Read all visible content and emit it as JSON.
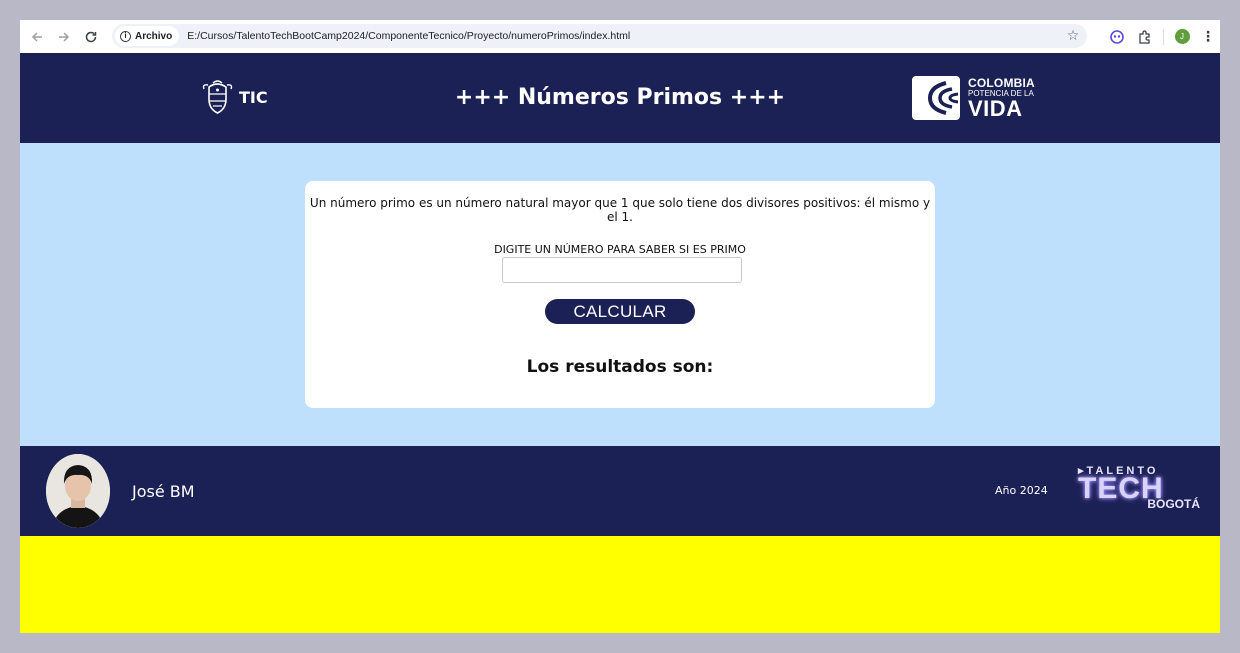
{
  "browser": {
    "chip_label": "Archivo",
    "url": "E:/Cursos/TalentoTechBootCamp2024/ComponenteTecnico/Proyecto/numeroPrimos/index.html",
    "profile_initial": "J"
  },
  "header": {
    "left_logo_text": "TIC",
    "title": "+++ Números Primos +++",
    "right_logo": {
      "line1": "COLOMBIA",
      "line2": "POTENCIA DE LA",
      "line3": "VIDA"
    }
  },
  "card": {
    "description": "Un número primo es un número natural mayor que 1 que solo tiene dos divisores positivos: él mismo y el 1.",
    "input_label": "DIGITE UN NÚMERO PARA SABER SI ES PRIMO",
    "input_value": "",
    "button_label": "CALCULAR",
    "results_heading": "Los resultados son:"
  },
  "footer": {
    "author": "José BM",
    "year": "Año 2024",
    "logo": {
      "top": "TALENTO",
      "middle": "TECH",
      "bottom": "BOGOTÁ"
    }
  },
  "colors": {
    "navy": "#1c2155",
    "light_blue": "#bfe0fc",
    "yellow": "#ffff00",
    "frame": "#b9b8c6"
  }
}
